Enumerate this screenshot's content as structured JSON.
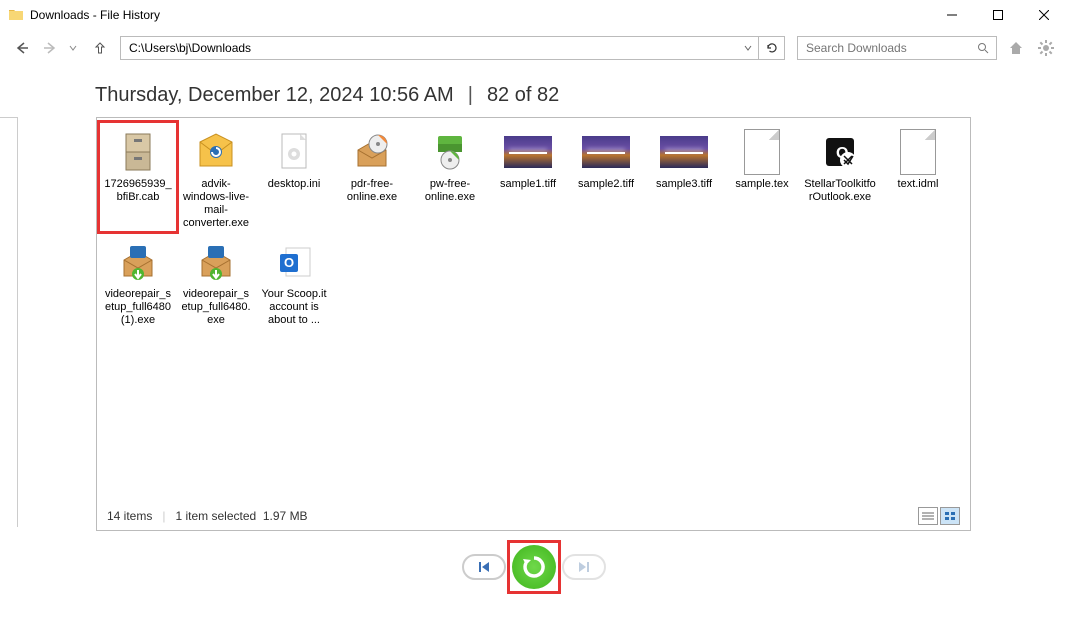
{
  "window": {
    "title": "Downloads - File History"
  },
  "toolbar": {
    "path": "C:\\Users\\bj\\Downloads",
    "search_placeholder": "Search Downloads"
  },
  "header": {
    "timestamp": "Thursday, December 12, 2024 10:56 AM",
    "position": "82 of 82"
  },
  "files": [
    {
      "label": "1726965939_bfiBr.cab",
      "icon": "cabinet",
      "selected": true
    },
    {
      "label": "advik-windows-live-mail-converter.exe",
      "icon": "envelope",
      "selected": false
    },
    {
      "label": "desktop.ini",
      "icon": "gear-doc",
      "selected": false
    },
    {
      "label": "pdr-free-online.exe",
      "icon": "box-disc",
      "selected": false
    },
    {
      "label": "pw-free-online.exe",
      "icon": "box-green",
      "selected": false
    },
    {
      "label": "sample1.tiff",
      "icon": "tiff",
      "selected": false
    },
    {
      "label": "sample2.tiff",
      "icon": "tiff",
      "selected": false
    },
    {
      "label": "sample3.tiff",
      "icon": "tiff",
      "selected": false
    },
    {
      "label": "sample.tex",
      "icon": "blank",
      "selected": false
    },
    {
      "label": "StellarToolkitforOutlook.exe",
      "icon": "outlook-tool",
      "selected": false
    },
    {
      "label": "text.idml",
      "icon": "blank",
      "selected": false
    },
    {
      "label": "videorepair_setup_full6480 (1).exe",
      "icon": "box-down",
      "selected": false
    },
    {
      "label": "videorepair_setup_full6480.exe",
      "icon": "box-down",
      "selected": false
    },
    {
      "label": "Your Scoop.it account is about to ...",
      "icon": "outlook-msg",
      "selected": false
    }
  ],
  "status": {
    "count": "14 items",
    "selected": "1 item selected",
    "size": "1.97 MB"
  }
}
